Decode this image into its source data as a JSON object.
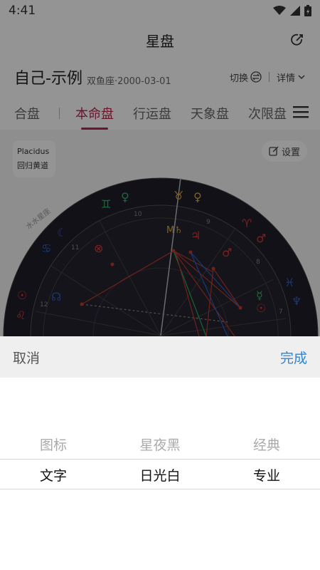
{
  "status_bar": {
    "time": "4:41"
  },
  "nav": {
    "title": "星盘"
  },
  "profile": {
    "name": "自己-示例",
    "subtitle": "双鱼座·2000-03-01",
    "switch_label": "切换",
    "details_label": "详情"
  },
  "tabs": [
    {
      "label": "合盘"
    },
    {
      "label": "本命盘"
    },
    {
      "label": "行运盘"
    },
    {
      "label": "天象盘"
    },
    {
      "label": "次限盘"
    }
  ],
  "chart": {
    "house_system": "Placidus",
    "zodiac": "回归黄道",
    "settings_label": "设置",
    "watermark": "水水星座",
    "house_numbers": [
      "10",
      "9",
      "11",
      "8",
      "12",
      "7"
    ]
  },
  "sheet": {
    "cancel_label": "取消",
    "done_label": "完成",
    "rows": [
      {
        "cells": [
          "图标",
          "星夜黑",
          "经典"
        ]
      },
      {
        "cells": [
          "文字",
          "日光白",
          "专业"
        ]
      }
    ]
  },
  "colors": {
    "accent": "#b8254f",
    "done": "#2a86d6",
    "wheel_bg": "#1e1e28"
  }
}
